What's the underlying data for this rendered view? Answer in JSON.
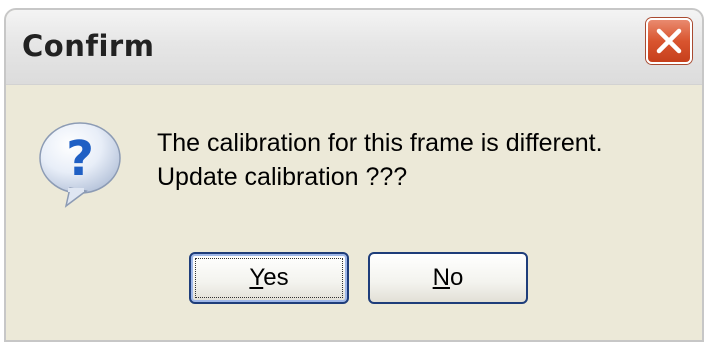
{
  "dialog": {
    "title": "Confirm",
    "message_line1": "The calibration for this frame is different.",
    "message_line2": "Update calibration ???",
    "icon": "question-icon"
  },
  "buttons": {
    "yes": {
      "mnemonic": "Y",
      "rest": "es"
    },
    "no": {
      "mnemonic": "N",
      "rest": "o"
    }
  },
  "colors": {
    "window_bg": "#ece9d8",
    "close_button": "#d9552f",
    "button_border": "#1e3d7a",
    "icon_blue": "#1f5fc4"
  }
}
